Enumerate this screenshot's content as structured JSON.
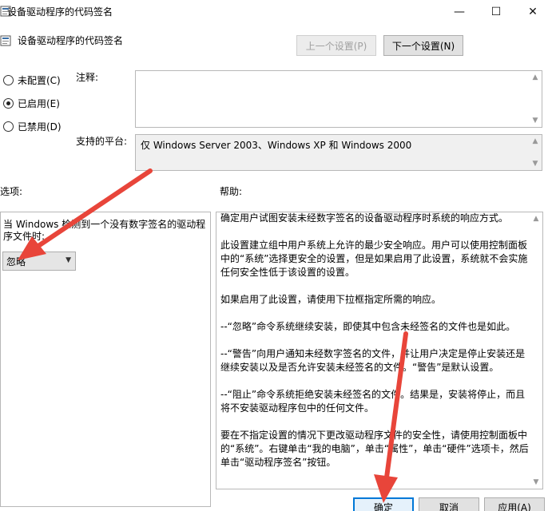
{
  "window": {
    "title": "设备驱动程序的代码签名",
    "minimize_glyph": "—",
    "maximize_glyph": "☐",
    "close_glyph": "✕"
  },
  "header": {
    "title": "设备驱动程序的代码签名",
    "prev_setting": "上一个设置(P)",
    "next_setting": "下一个设置(N)"
  },
  "state": {
    "radios": [
      {
        "label": "未配置(C)",
        "checked": false
      },
      {
        "label": "已启用(E)",
        "checked": true
      },
      {
        "label": "已禁用(D)",
        "checked": false
      }
    ]
  },
  "comment": {
    "label": "注释:",
    "value": ""
  },
  "platform": {
    "label": "支持的平台:",
    "value": "仅 Windows Server 2003、Windows XP 和 Windows 2000"
  },
  "options": {
    "label": "选项:",
    "prompt": "当 Windows 检测到一个没有数字签名的驱动程序文件时:",
    "selected": "忽略"
  },
  "help": {
    "label": "帮助:",
    "paragraphs": [
      "确定用户试图安装未经数字签名的设备驱动程序时系统的响应方式。",
      "此设置建立组中用户系统上允许的最少安全响应。用户可以使用控制面板中的“系统”选择更安全的设置，但是如果启用了此设置，系统就不会实施任何安全性低于该设置的设置。",
      "如果启用了此设置，请使用下拉框指定所需的响应。",
      "--“忽略”命令系统继续安装，即使其中包含未经签名的文件也是如此。",
      "--“警告”向用户通知未经数字签名的文件，并让用户决定是停止安装还是继续安装以及是否允许安装未经签名的文件。“警告”是默认设置。",
      "--“阻止”命令系统拒绝安装未经签名的文件。结果是，安装将停止，而且将不安装驱动程序包中的任何文件。",
      "要在不指定设置的情况下更改驱动程序文件的安全性，请使用控制面板中的“系统”。右键单击“我的电脑”，单击“属性”，单击“硬件”选项卡，然后单击“驱动程序签名”按钮。"
    ]
  },
  "footer": {
    "ok": "确定",
    "cancel": "取消",
    "apply": "应用(A)"
  },
  "colors": {
    "annotation_arrow": "#e8453a",
    "focus_border": "#0078d7"
  }
}
